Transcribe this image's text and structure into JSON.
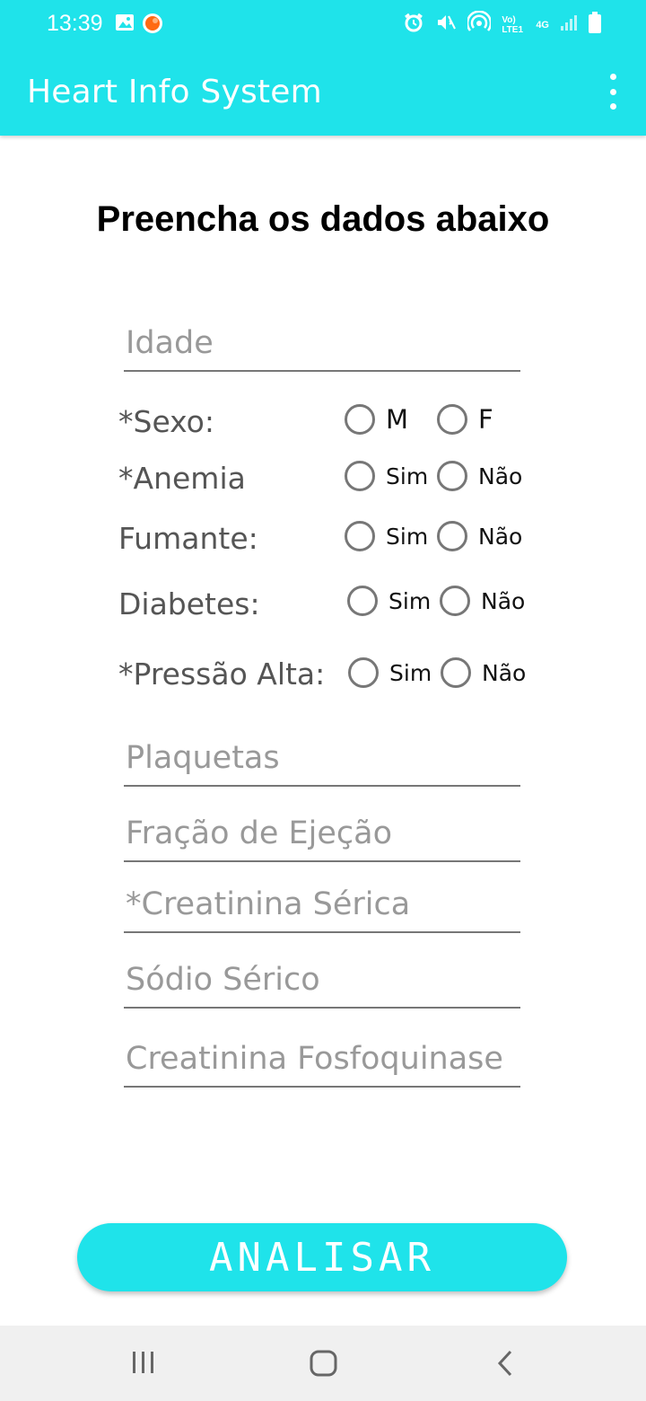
{
  "status_bar": {
    "time": "13:39",
    "icons": [
      "image-icon",
      "notification-dot-icon",
      "alarm-icon",
      "mute-icon",
      "hotspot-icon",
      "volte-icon",
      "4g-icon",
      "signal-icon",
      "battery-icon"
    ],
    "volte_text": "Vo) LTE1",
    "network_text": "4G"
  },
  "app_bar": {
    "title": "Heart Info System"
  },
  "form": {
    "heading": "Preencha os dados abaixo",
    "idade_placeholder": "Idade",
    "sexo": {
      "label": "*Sexo:",
      "opt1": "M",
      "opt2": "F"
    },
    "anemia": {
      "label": "*Anemia",
      "opt1": "Sim",
      "opt2": "Não"
    },
    "fumante": {
      "label": "Fumante:",
      "opt1": "Sim",
      "opt2": "Não"
    },
    "diabetes": {
      "label": "Diabetes:",
      "opt1": "Sim",
      "opt2": "Não"
    },
    "pressao": {
      "label": "*Pressão Alta:",
      "opt1": "Sim",
      "opt2": "Não"
    },
    "plaquetas_placeholder": "Plaquetas",
    "fracao_placeholder": "Fração de Ejeção",
    "creatinina_placeholder": "*Creatinina Sérica",
    "sodio_placeholder": "Sódio Sérico",
    "cpk_placeholder": "Creatinina Fosfoquinase",
    "submit_label": "ANALISAR"
  },
  "colors": {
    "accent": "#1fe3ea",
    "navbar": "#f0f0f0"
  }
}
